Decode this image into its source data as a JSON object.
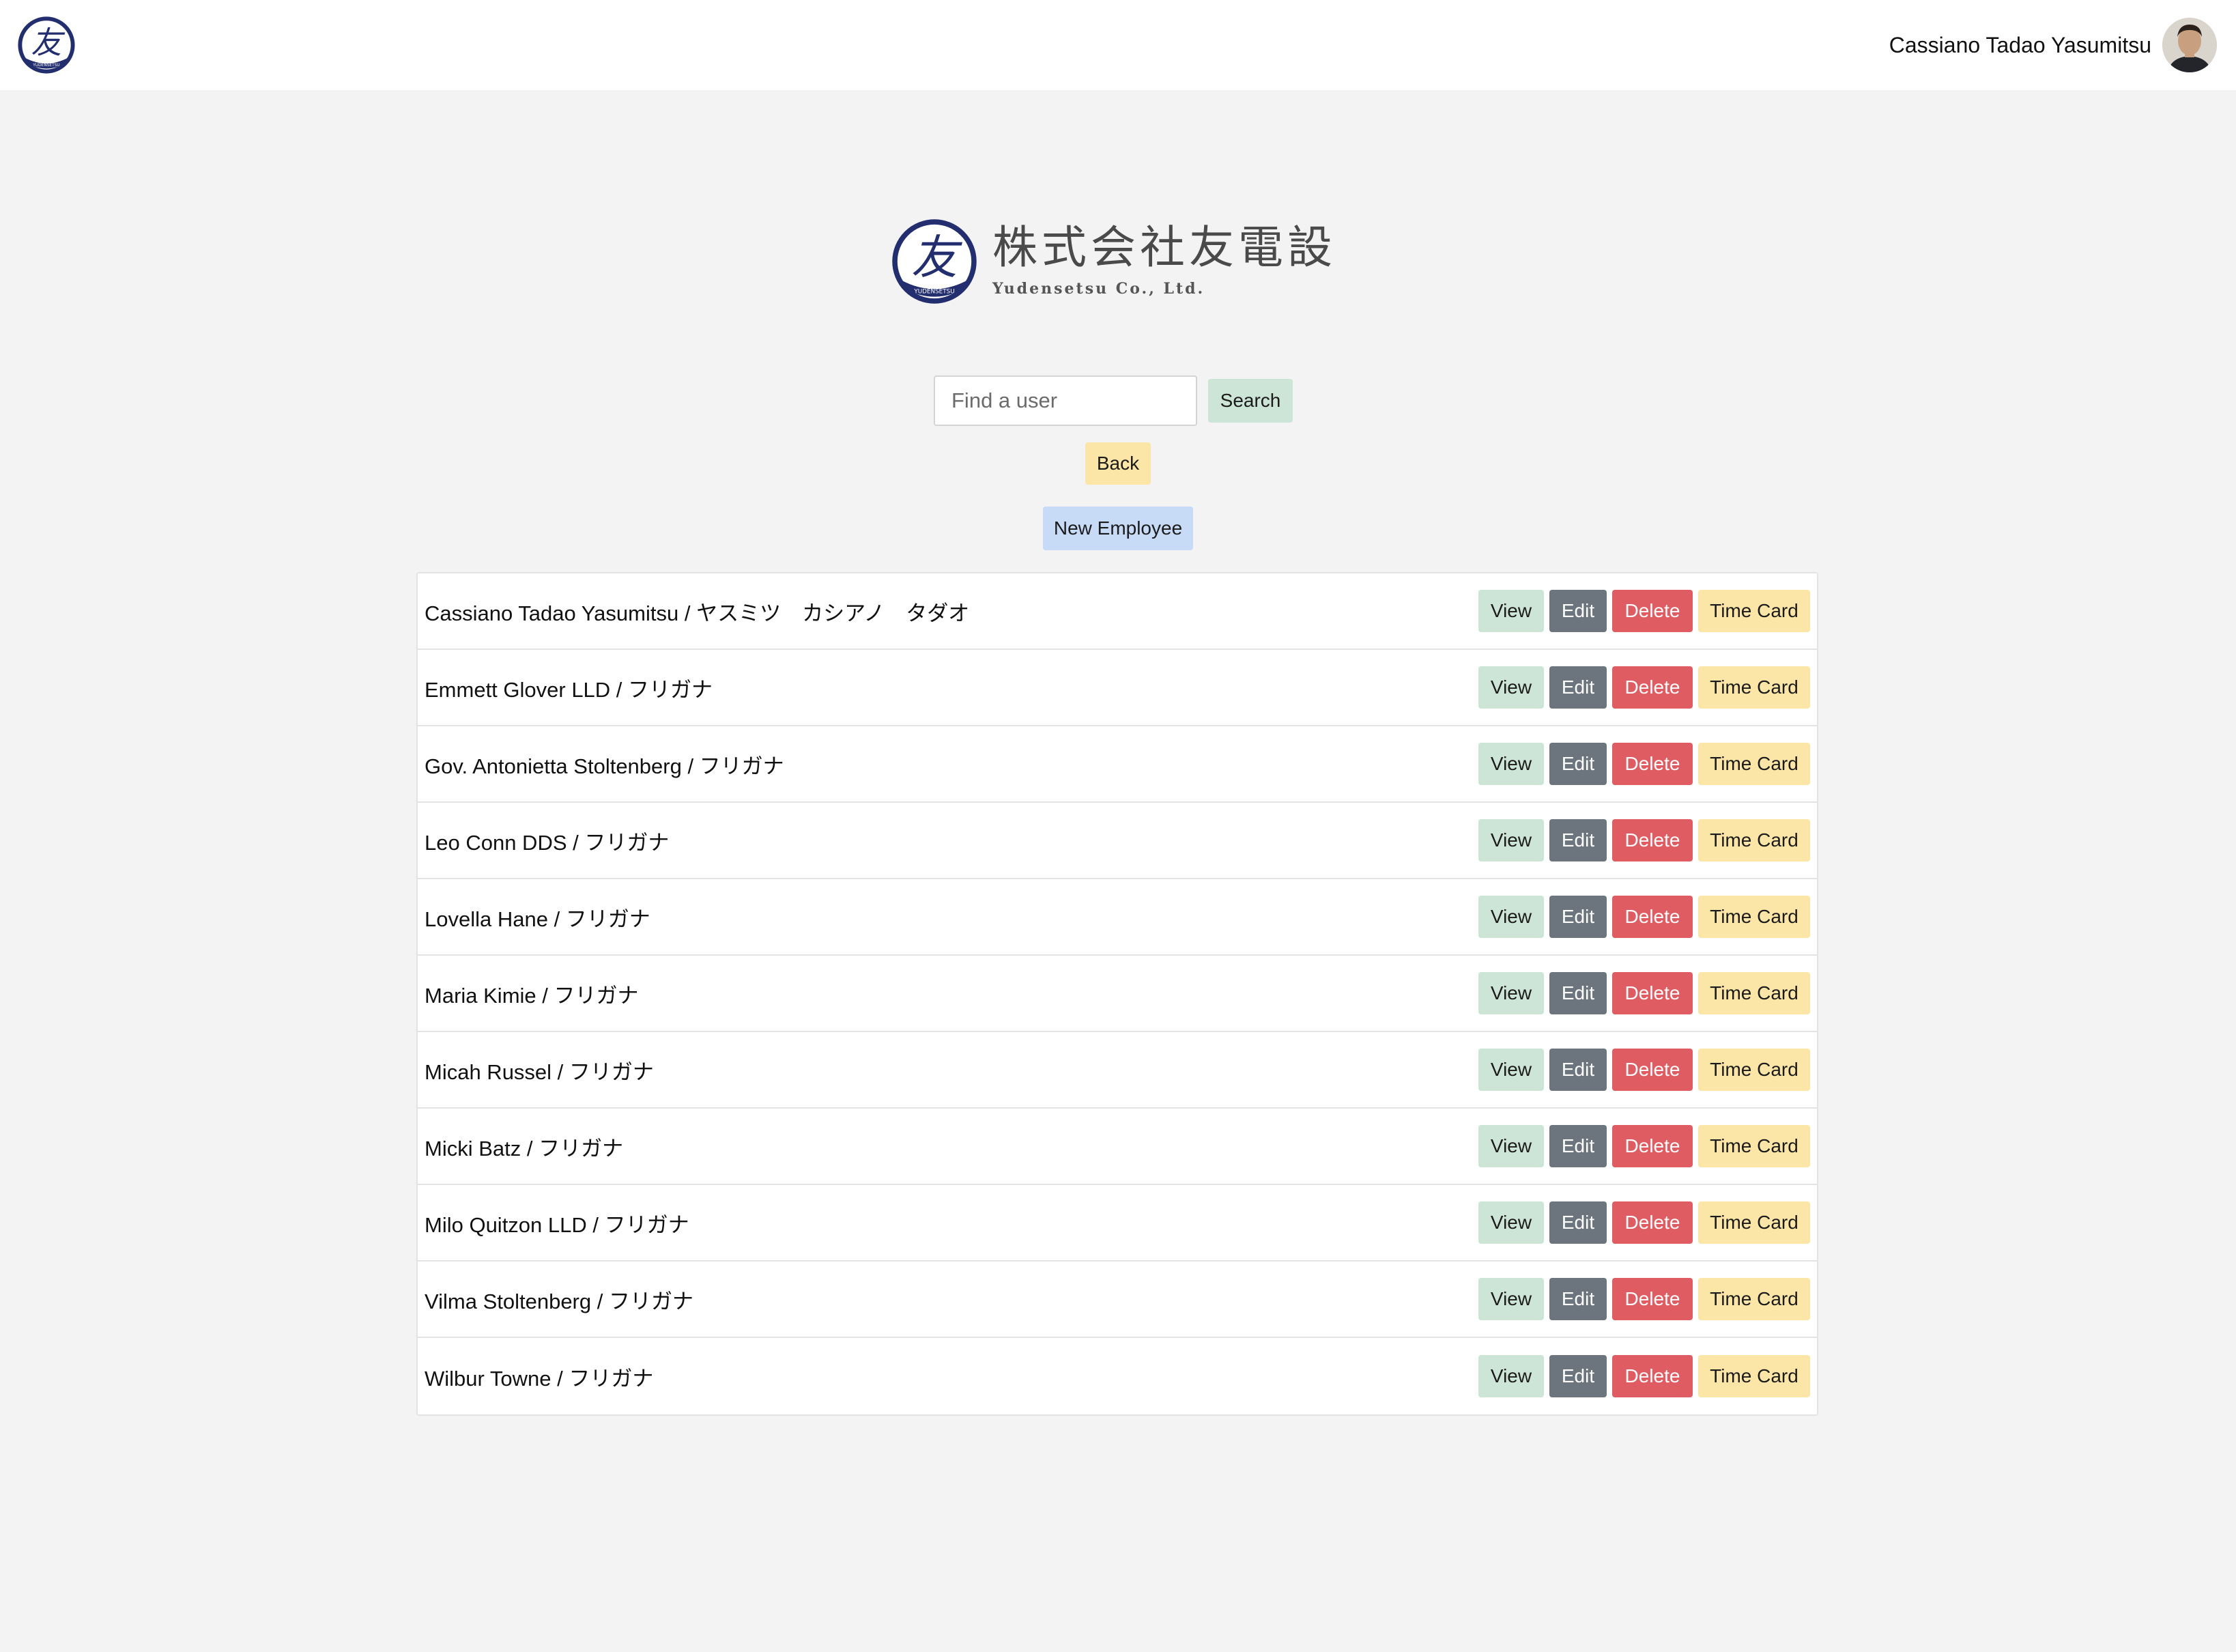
{
  "header": {
    "logo_label": "友",
    "logo_caption": "YUDENSETSU",
    "user_name": "Cassiano Tadao Yasumitsu"
  },
  "brand": {
    "emblem_char": "友",
    "emblem_caption": "YUDENSETSU",
    "name_ja": "株式会社友電設",
    "name_en": "Yudensetsu Co., Ltd."
  },
  "search": {
    "placeholder": "Find a user",
    "value": "",
    "button_label": "Search"
  },
  "nav": {
    "back_label": "Back",
    "new_employee_label": "New Employee"
  },
  "row_actions": {
    "view": "View",
    "edit": "Edit",
    "delete": "Delete",
    "time_card": "Time Card"
  },
  "colors": {
    "brand_navy": "#232e6e",
    "view_bg": "#cde5d6",
    "edit_bg": "#6c757d",
    "delete_bg": "#e05c63",
    "time_card_bg": "#fbe6a8",
    "new_employee_bg": "#c7dbf7"
  },
  "employees": [
    "Cassiano Tadao Yasumitsu / ヤスミツ　カシアノ　タダオ",
    "Emmett Glover LLD / フリガナ",
    "Gov. Antonietta Stoltenberg / フリガナ",
    "Leo Conn DDS / フリガナ",
    "Lovella Hane / フリガナ",
    "Maria Kimie / フリガナ",
    "Micah Russel / フリガナ",
    "Micki Batz / フリガナ",
    "Milo Quitzon LLD / フリガナ",
    "Vilma Stoltenberg / フリガナ",
    "Wilbur Towne / フリガナ"
  ]
}
